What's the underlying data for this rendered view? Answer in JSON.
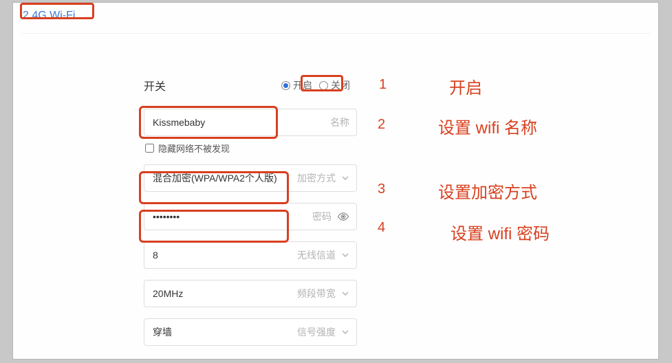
{
  "tab": {
    "title": "2.4G Wi-Fi"
  },
  "switch": {
    "label": "开关",
    "on_label": "开启",
    "off_label": "关闭",
    "selected": "on"
  },
  "ssid": {
    "value": "Kissmebaby",
    "caption": "名称"
  },
  "hide": {
    "label": "隐藏网络不被发现",
    "checked": false
  },
  "encryption": {
    "value": "混合加密(WPA/WPA2个人版)",
    "caption": "加密方式"
  },
  "password": {
    "value": "••••••••",
    "caption": "密码"
  },
  "channel": {
    "value": "8",
    "caption": "无线信道"
  },
  "bandwidth": {
    "value": "20MHz",
    "caption": "频段带宽"
  },
  "signal": {
    "value": "穿墙",
    "caption": "信号强度"
  },
  "annotations": {
    "n1": "1",
    "n2": "2",
    "n3": "3",
    "n4": "4",
    "t1": "开启",
    "t2": "设置 wifi 名称",
    "t3": "设置加密方式",
    "t4": "设置 wifi 密码"
  }
}
